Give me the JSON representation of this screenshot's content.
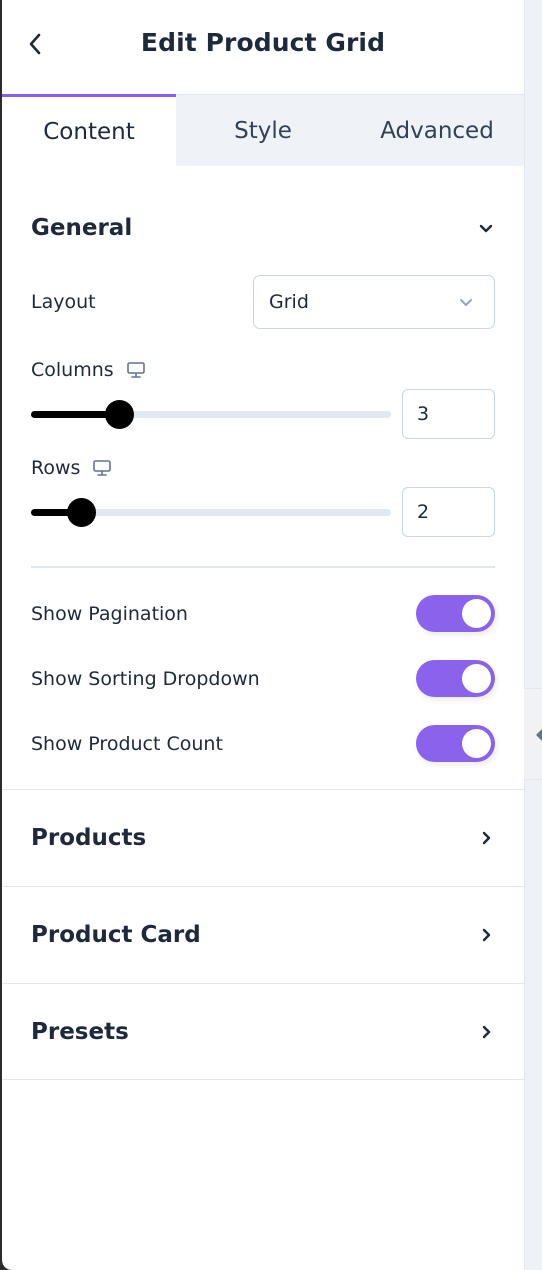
{
  "header": {
    "title": "Edit Product Grid",
    "back_icon": "chevron-left"
  },
  "tabs": [
    {
      "label": "Content",
      "active": true
    },
    {
      "label": "Style",
      "active": false
    },
    {
      "label": "Advanced",
      "active": false
    }
  ],
  "general": {
    "title": "General",
    "expanded": true,
    "layout": {
      "label": "Layout",
      "value": "Grid"
    },
    "columns": {
      "label": "Columns",
      "value": "3",
      "slider_fraction": 0.245,
      "device_icon": "desktop-monitor"
    },
    "rows": {
      "label": "Rows",
      "value": "2",
      "slider_fraction": 0.14,
      "device_icon": "desktop-monitor"
    },
    "toggles": [
      {
        "label": "Show Pagination",
        "on": true
      },
      {
        "label": "Show Sorting Dropdown",
        "on": true
      },
      {
        "label": "Show Product Count",
        "on": true
      }
    ]
  },
  "sections": [
    {
      "label": "Products"
    },
    {
      "label": "Product Card"
    },
    {
      "label": "Presets"
    }
  ],
  "colors": {
    "accent": "#8b5cf6",
    "toggle_on": "#8b62ec",
    "text": "#1e293b"
  }
}
